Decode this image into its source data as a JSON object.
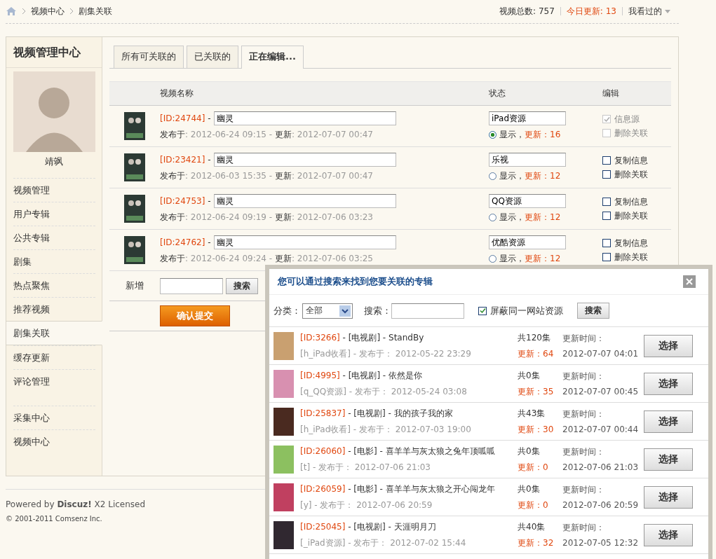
{
  "breadcrumb": [
    {
      "label": "视频中心"
    },
    {
      "label": "剧集关联"
    }
  ],
  "stats": {
    "total": "视频总数: 757",
    "today": "今日更新: 13",
    "history": "我看过的"
  },
  "sidebar": {
    "title": "视频管理中心",
    "user_name": "靖飒",
    "items": [
      {
        "label": "视频管理",
        "selected": false
      },
      {
        "label": "用户专辑",
        "selected": false
      },
      {
        "label": "公共专辑",
        "selected": false
      },
      {
        "label": "剧集",
        "selected": false
      },
      {
        "label": "热点聚焦",
        "selected": false
      },
      {
        "label": "推荐视频",
        "selected": false
      },
      {
        "label": "剧集关联",
        "selected": true
      },
      {
        "label": "缓存更新",
        "selected": false
      },
      {
        "label": "评论管理",
        "selected": false
      },
      {
        "label": "采集中心",
        "selected": false
      },
      {
        "label": "视频中心",
        "selected": false
      }
    ]
  },
  "tabs": [
    {
      "label": "所有可关联的",
      "selected": false
    },
    {
      "label": "已关联的",
      "selected": false
    },
    {
      "label": "正在编辑...",
      "selected": true
    }
  ],
  "table": {
    "columns": [
      "视频名称",
      "状态",
      "编辑"
    ],
    "rows": [
      {
        "id": "[ID:24744]",
        "dash": "-",
        "title": "幽灵",
        "pub_label": "发布于",
        "pub_value": ": 2012-06-24 09:15 - ",
        "upd_label": "更新",
        "upd_value": ": 2012-07-07 00:47",
        "source": "iPad资源",
        "selected": true,
        "show": "显示，",
        "updates": "更新：16",
        "options": [
          {
            "label": "信息源",
            "checked": true,
            "disabled": true
          },
          {
            "label": "删除关联",
            "checked": false,
            "disabled": true
          }
        ]
      },
      {
        "id": "[ID:23421]",
        "dash": "-",
        "title": "幽灵",
        "pub_label": "发布于",
        "pub_value": ": 2012-06-03 15:35 - ",
        "upd_label": "更新",
        "upd_value": ": 2012-07-07 00:47",
        "source": "乐视",
        "selected": false,
        "show": "显示，",
        "updates": "更新：12",
        "options": [
          {
            "label": "复制信息",
            "checked": false,
            "disabled": false
          },
          {
            "label": "删除关联",
            "checked": false,
            "disabled": false
          }
        ]
      },
      {
        "id": "[ID:24753]",
        "dash": "-",
        "title": "幽灵",
        "pub_label": "发布于",
        "pub_value": ": 2012-06-24 09:19 - ",
        "upd_label": "更新",
        "upd_value": ": 2012-07-06 03:23",
        "source": "QQ资源",
        "selected": false,
        "show": "显示，",
        "updates": "更新：12",
        "options": [
          {
            "label": "复制信息",
            "checked": false,
            "disabled": false
          },
          {
            "label": "删除关联",
            "checked": false,
            "disabled": false
          }
        ]
      },
      {
        "id": "[ID:24762]",
        "dash": "-",
        "title": "幽灵",
        "pub_label": "发布于",
        "pub_value": ": 2012-06-24 09:24 - ",
        "upd_label": "更新",
        "upd_value": ": 2012-07-06 03:25",
        "source": "优酷资源",
        "selected": false,
        "show": "显示，",
        "updates": "更新：12",
        "options": [
          {
            "label": "复制信息",
            "checked": false,
            "disabled": false
          },
          {
            "label": "删除关联",
            "checked": false,
            "disabled": false
          }
        ]
      }
    ],
    "add_label": "新增",
    "add_button": "搜索",
    "submit": "确认提交"
  },
  "dialog": {
    "title": "您可以通过搜索来找到您要关联的专辑",
    "category_label": "分类：",
    "category": "全部",
    "search_label": "搜索：",
    "filter": {
      "label": "屏蔽同一网站资源",
      "checked": true
    },
    "search_button": "搜索",
    "results": [
      {
        "id": "[ID:3266]",
        "category": "- [电视剧] -",
        "name": "StandBy",
        "source": "[h_iPad收看]",
        "published": "- 发布于： 2012-05-22 23:29",
        "episodes": "共120集",
        "updates": "更新：64",
        "time_label": "更新时间：",
        "time": "2012-07-07 04:01",
        "button": "选择",
        "color": "#c9a070"
      },
      {
        "id": "[ID:4995]",
        "category": "- [电视剧] -",
        "name": "依然是你",
        "source": "[q_QQ资源]",
        "published": "- 发布于： 2012-05-24 03:08",
        "episodes": "共0集",
        "updates": "更新：35",
        "time_label": "更新时间：",
        "time": "2012-07-07 00:45",
        "button": "选择",
        "color": "#d890b0"
      },
      {
        "id": "[ID:25837]",
        "category": "- [电视剧] -",
        "name": "我的孩子我的家",
        "source": "[h_iPad收看]",
        "published": "- 发布于： 2012-07-03 19:00",
        "episodes": "共43集",
        "updates": "更新：30",
        "time_label": "更新时间：",
        "time": "2012-07-07 00:44",
        "button": "选择",
        "color": "#4a2a20"
      },
      {
        "id": "[ID:26060]",
        "category": "- [电影] -",
        "name": "喜羊羊与灰太狼之兔年顶呱呱",
        "source": "[t]",
        "published": "- 发布于： 2012-07-06 21:03",
        "episodes": "共0集",
        "updates": "更新：0",
        "time_label": "更新时间：",
        "time": "2012-07-06 21:03",
        "button": "选择",
        "color": "#8cc060"
      },
      {
        "id": "[ID:26059]",
        "category": "- [电影] -",
        "name": "喜羊羊与灰太狼之开心闯龙年",
        "source": "[y]",
        "published": "- 发布于： 2012-07-06 20:59",
        "episodes": "共0集",
        "updates": "更新：0",
        "time_label": "更新时间：",
        "time": "2012-07-06 20:59",
        "button": "选择",
        "color": "#c04060"
      },
      {
        "id": "[ID:25045]",
        "category": "- [电视剧] -",
        "name": "天涯明月刀",
        "source": "[_iPad资源]",
        "published": "- 发布于： 2012-07-02 15:44",
        "episodes": "共40集",
        "updates": "更新：32",
        "time_label": "更新时间：",
        "time": "2012-07-05 12:32",
        "button": "选择",
        "color": "#302830"
      }
    ]
  },
  "footer": {
    "powered": "Powered by **Discuz!** X2 Licensed",
    "copyright": "© 2001-2011 Comsenz Inc."
  }
}
